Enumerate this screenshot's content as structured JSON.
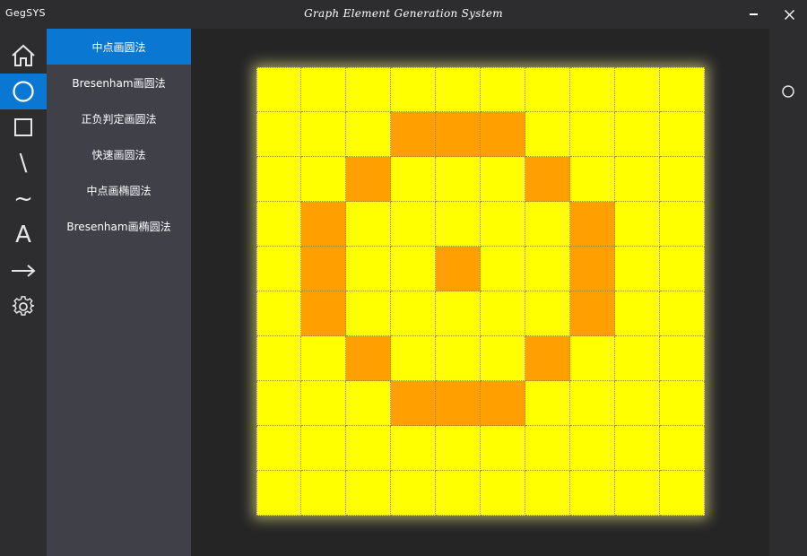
{
  "titlebar": {
    "app_name": "GegSYS",
    "window_title": "Graph Element Generation System"
  },
  "iconbar": {
    "items": [
      {
        "name": "home-icon",
        "active": false
      },
      {
        "name": "circle-icon",
        "active": true
      },
      {
        "name": "square-icon",
        "active": false
      },
      {
        "name": "line-icon",
        "active": false,
        "glyph": "\\"
      },
      {
        "name": "curve-icon",
        "active": false,
        "glyph": "~"
      },
      {
        "name": "text-icon",
        "active": false,
        "glyph": "A"
      },
      {
        "name": "arrow-icon",
        "active": false
      },
      {
        "name": "gear-icon",
        "active": false
      }
    ]
  },
  "submenu": {
    "items": [
      {
        "label": "中点画圆法",
        "active": true
      },
      {
        "label": "Bresenham画圆法",
        "active": false
      },
      {
        "label": "正负判定画圆法",
        "active": false
      },
      {
        "label": "快速画圆法",
        "active": false
      },
      {
        "label": "中点画椭圆法",
        "active": false
      },
      {
        "label": "Bresenham画椭圆法",
        "active": false
      }
    ]
  },
  "canvas": {
    "grid_cols": 10,
    "grid_rows": 10,
    "background_color": "#ffff00",
    "pixel_color": "#ffa000",
    "filled_cells": [
      [
        1,
        3
      ],
      [
        1,
        4
      ],
      [
        1,
        5
      ],
      [
        2,
        2
      ],
      [
        2,
        6
      ],
      [
        3,
        1
      ],
      [
        3,
        7
      ],
      [
        4,
        1
      ],
      [
        4,
        4
      ],
      [
        4,
        7
      ],
      [
        5,
        1
      ],
      [
        5,
        7
      ],
      [
        6,
        2
      ],
      [
        6,
        6
      ],
      [
        7,
        3
      ],
      [
        7,
        4
      ],
      [
        7,
        5
      ]
    ]
  },
  "rightbar": {
    "icon": "circle-outline-icon"
  },
  "colors": {
    "accent": "#0a78d2",
    "sidebar_bg": "#3f4048",
    "chrome_bg": "#2d2d30",
    "canvas_bg": "#252526"
  }
}
